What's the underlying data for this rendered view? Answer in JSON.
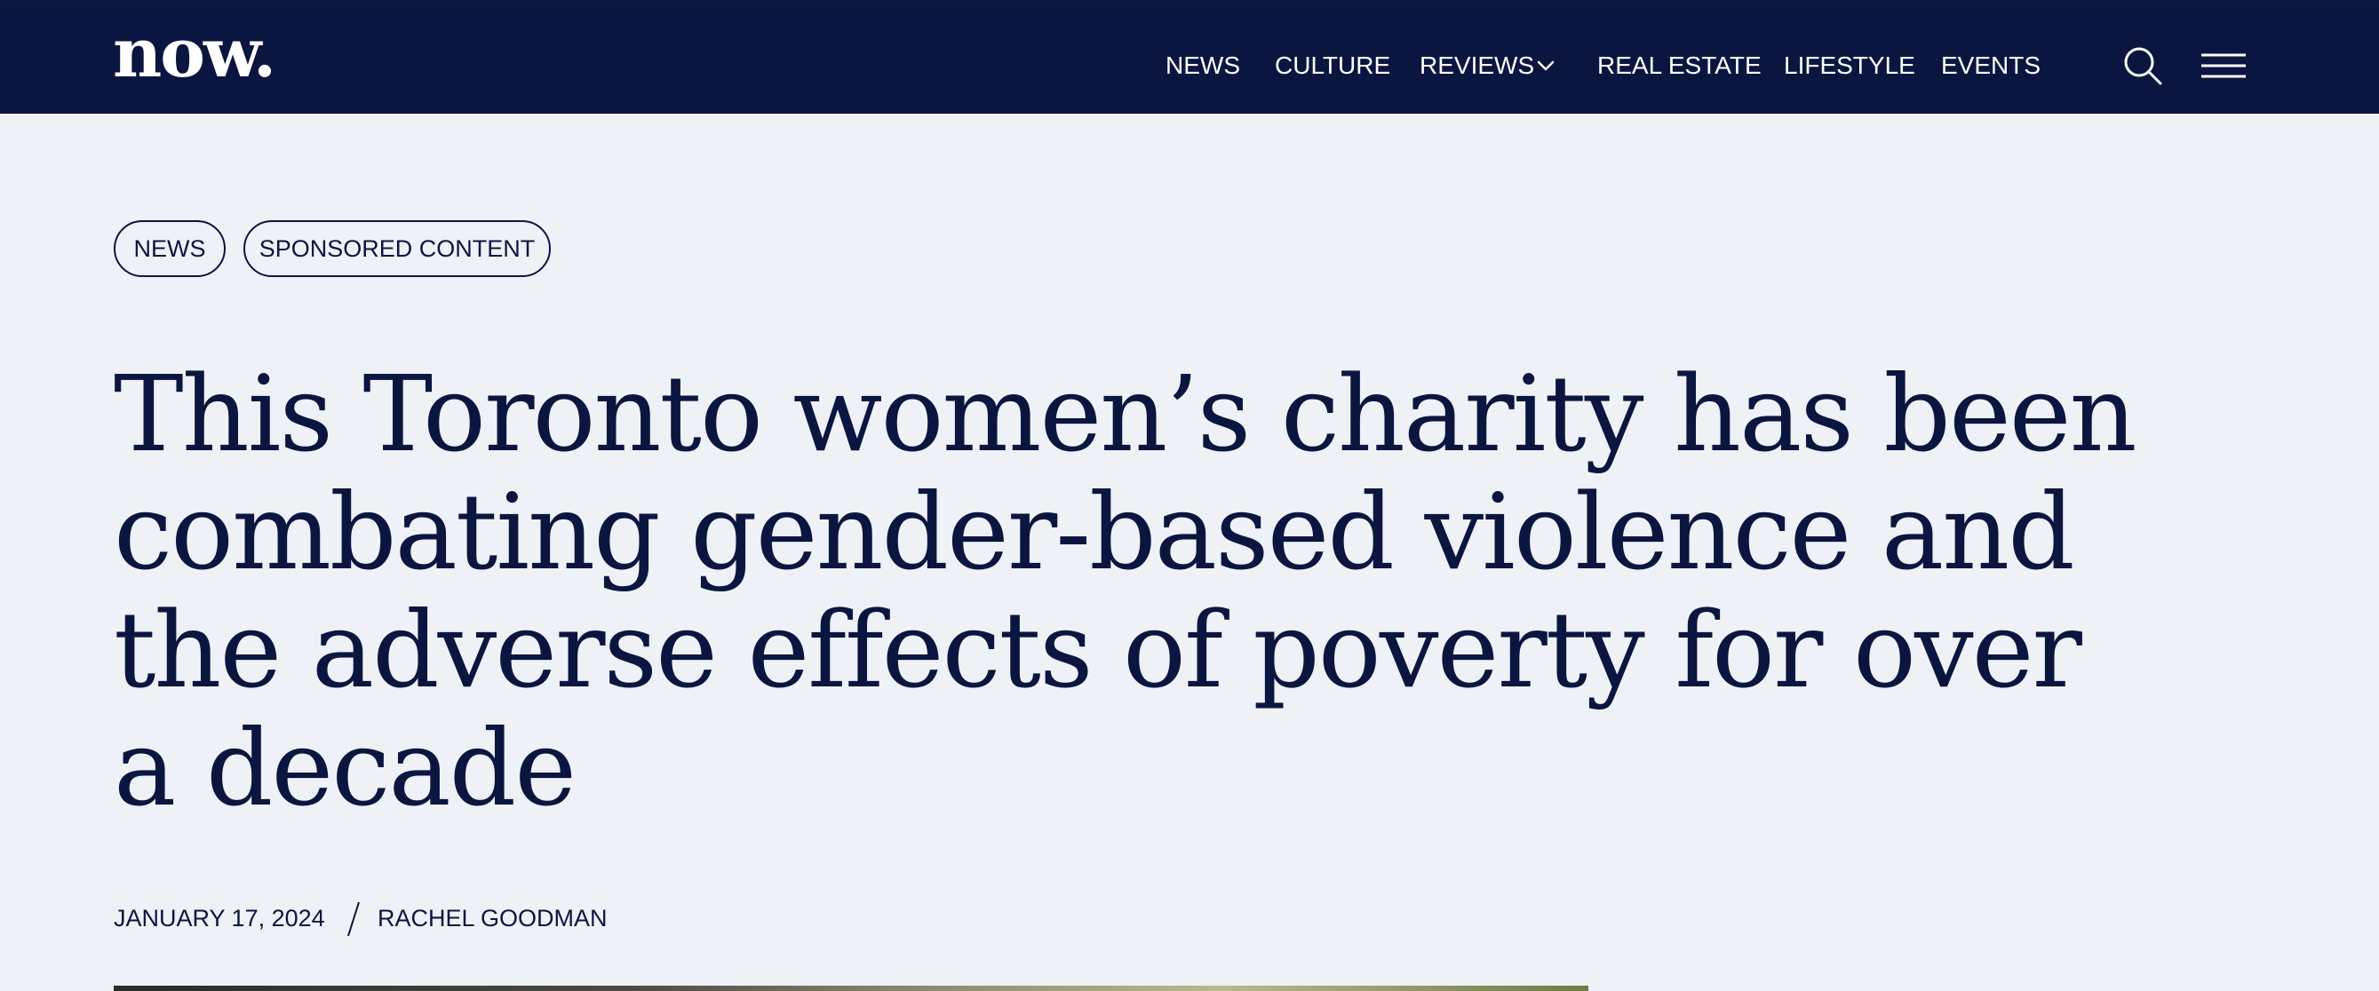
{
  "header": {
    "logo_text": "now.",
    "nav": [
      {
        "label": "NEWS"
      },
      {
        "label": "CULTURE"
      },
      {
        "label": "REVIEWS",
        "has_dropdown": true
      },
      {
        "label": "REAL ESTATE"
      },
      {
        "label": "LIFESTYLE"
      },
      {
        "label": "EVENTS"
      }
    ],
    "icons": {
      "search": "search-icon",
      "menu": "hamburger-menu-icon",
      "dropdown": "chevron-down-icon"
    }
  },
  "article": {
    "tags": [
      "NEWS",
      "SPONSORED CONTENT"
    ],
    "title": "This Toronto women’s charity has been combating gender-based violence and the adverse effects of poverty for over a decade",
    "date": "JANUARY 17, 2024",
    "separator": "/",
    "author": "RACHEL GOODMAN"
  },
  "colors": {
    "navy": "#0b1640",
    "background": "#eef1f6",
    "white": "#ffffff"
  }
}
